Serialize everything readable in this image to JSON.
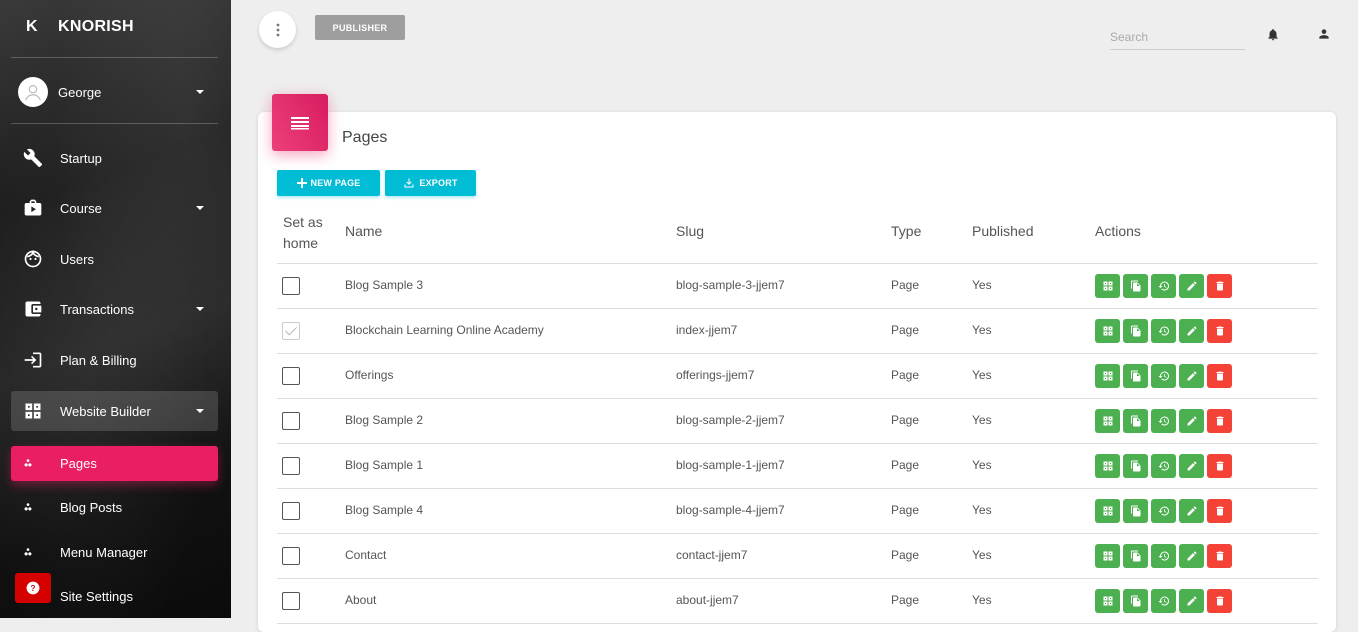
{
  "brand": {
    "mini": "K",
    "name": "KNORISH"
  },
  "user": {
    "name": "George"
  },
  "nav": {
    "startup": "Startup",
    "course": "Course",
    "users": "Users",
    "transactions": "Transactions",
    "plan_billing": "Plan & Billing",
    "website_builder": "Website Builder",
    "pages": "Pages",
    "blog_posts": "Blog Posts",
    "menu_manager": "Menu Manager",
    "site_settings": "Site Settings"
  },
  "topbar": {
    "publisher_label": "PUBLISHER",
    "search_placeholder": "Search"
  },
  "card": {
    "title": "Pages",
    "new_page_label": "NEW PAGE",
    "export_label": "EXPORT"
  },
  "table": {
    "headers": {
      "set_as_home_line1": "Set as",
      "set_as_home_line2": "home",
      "name": "Name",
      "slug": "Slug",
      "type": "Type",
      "published": "Published",
      "actions": "Actions"
    },
    "rows": [
      {
        "home": false,
        "name": "Blog Sample 3",
        "slug": "blog-sample-3-jjem7",
        "type": "Page",
        "published": "Yes"
      },
      {
        "home": true,
        "name": "Blockchain Learning Online Academy",
        "slug": "index-jjem7",
        "type": "Page",
        "published": "Yes"
      },
      {
        "home": false,
        "name": "Offerings",
        "slug": "offerings-jjem7",
        "type": "Page",
        "published": "Yes"
      },
      {
        "home": false,
        "name": "Blog Sample 2",
        "slug": "blog-sample-2-jjem7",
        "type": "Page",
        "published": "Yes"
      },
      {
        "home": false,
        "name": "Blog Sample 1",
        "slug": "blog-sample-1-jjem7",
        "type": "Page",
        "published": "Yes"
      },
      {
        "home": false,
        "name": "Blog Sample 4",
        "slug": "blog-sample-4-jjem7",
        "type": "Page",
        "published": "Yes"
      },
      {
        "home": false,
        "name": "Contact",
        "slug": "contact-jjem7",
        "type": "Page",
        "published": "Yes"
      },
      {
        "home": false,
        "name": "About",
        "slug": "about-jjem7",
        "type": "Page",
        "published": "Yes"
      }
    ]
  },
  "colors": {
    "accent_pink": "#e91e63",
    "cyan_button": "#00bcd4",
    "action_green": "#4caf50",
    "action_red": "#f44336",
    "help_red": "#d50000"
  },
  "icons": {
    "action_buttons": [
      "builder-icon",
      "copy-icon",
      "history-icon",
      "edit-icon",
      "delete-icon"
    ]
  }
}
